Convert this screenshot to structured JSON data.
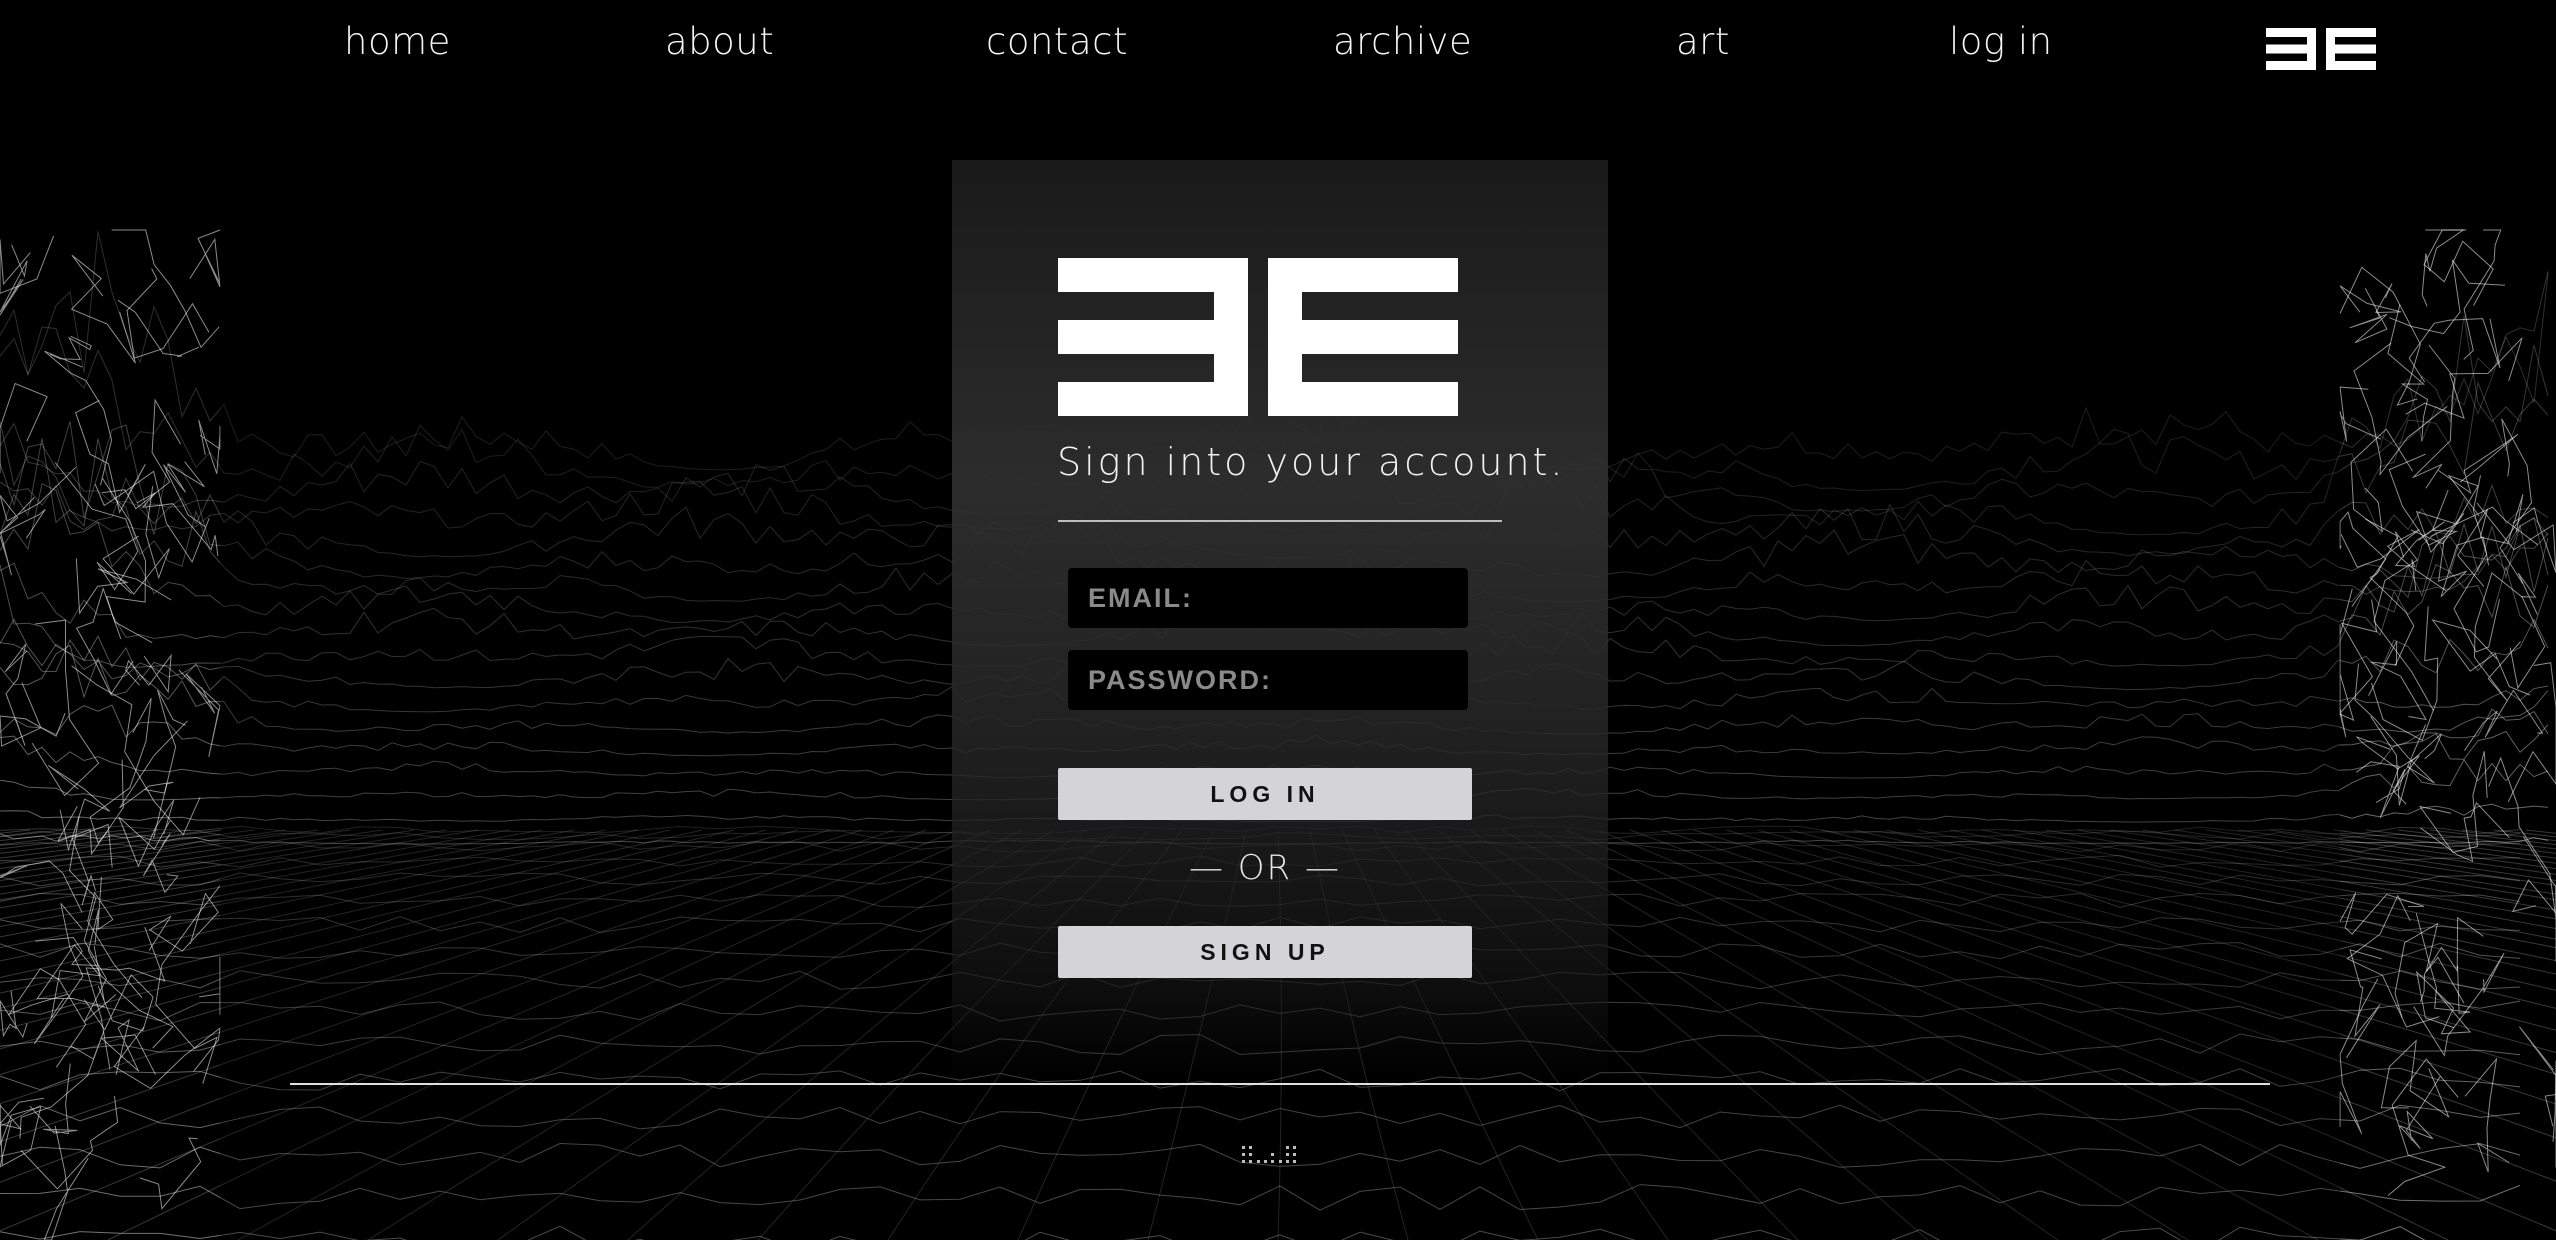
{
  "nav": {
    "items": [
      {
        "id": "home",
        "label": "home"
      },
      {
        "id": "about",
        "label": "about"
      },
      {
        "id": "contact",
        "label": "contact"
      },
      {
        "id": "archive",
        "label": "archive"
      },
      {
        "id": "art",
        "label": "art"
      },
      {
        "id": "login",
        "label": "log in"
      }
    ],
    "logo_icon": "3e-logo-icon"
  },
  "login_form": {
    "heading": "Sign into your account.",
    "email_placeholder": "EMAIL:",
    "password_placeholder": "PASSWORD:",
    "login_label": "LOG IN",
    "or_label": "— OR —",
    "signup_label": "SIGN UP"
  },
  "footer": {
    "mark_icon": "dotted-mark-icon"
  },
  "colors": {
    "background": "#000000",
    "text": "#f4f4f4",
    "panel": "#303030",
    "button": "#d4d4d8",
    "field": "#000000",
    "wireframe": "#ffffff"
  }
}
